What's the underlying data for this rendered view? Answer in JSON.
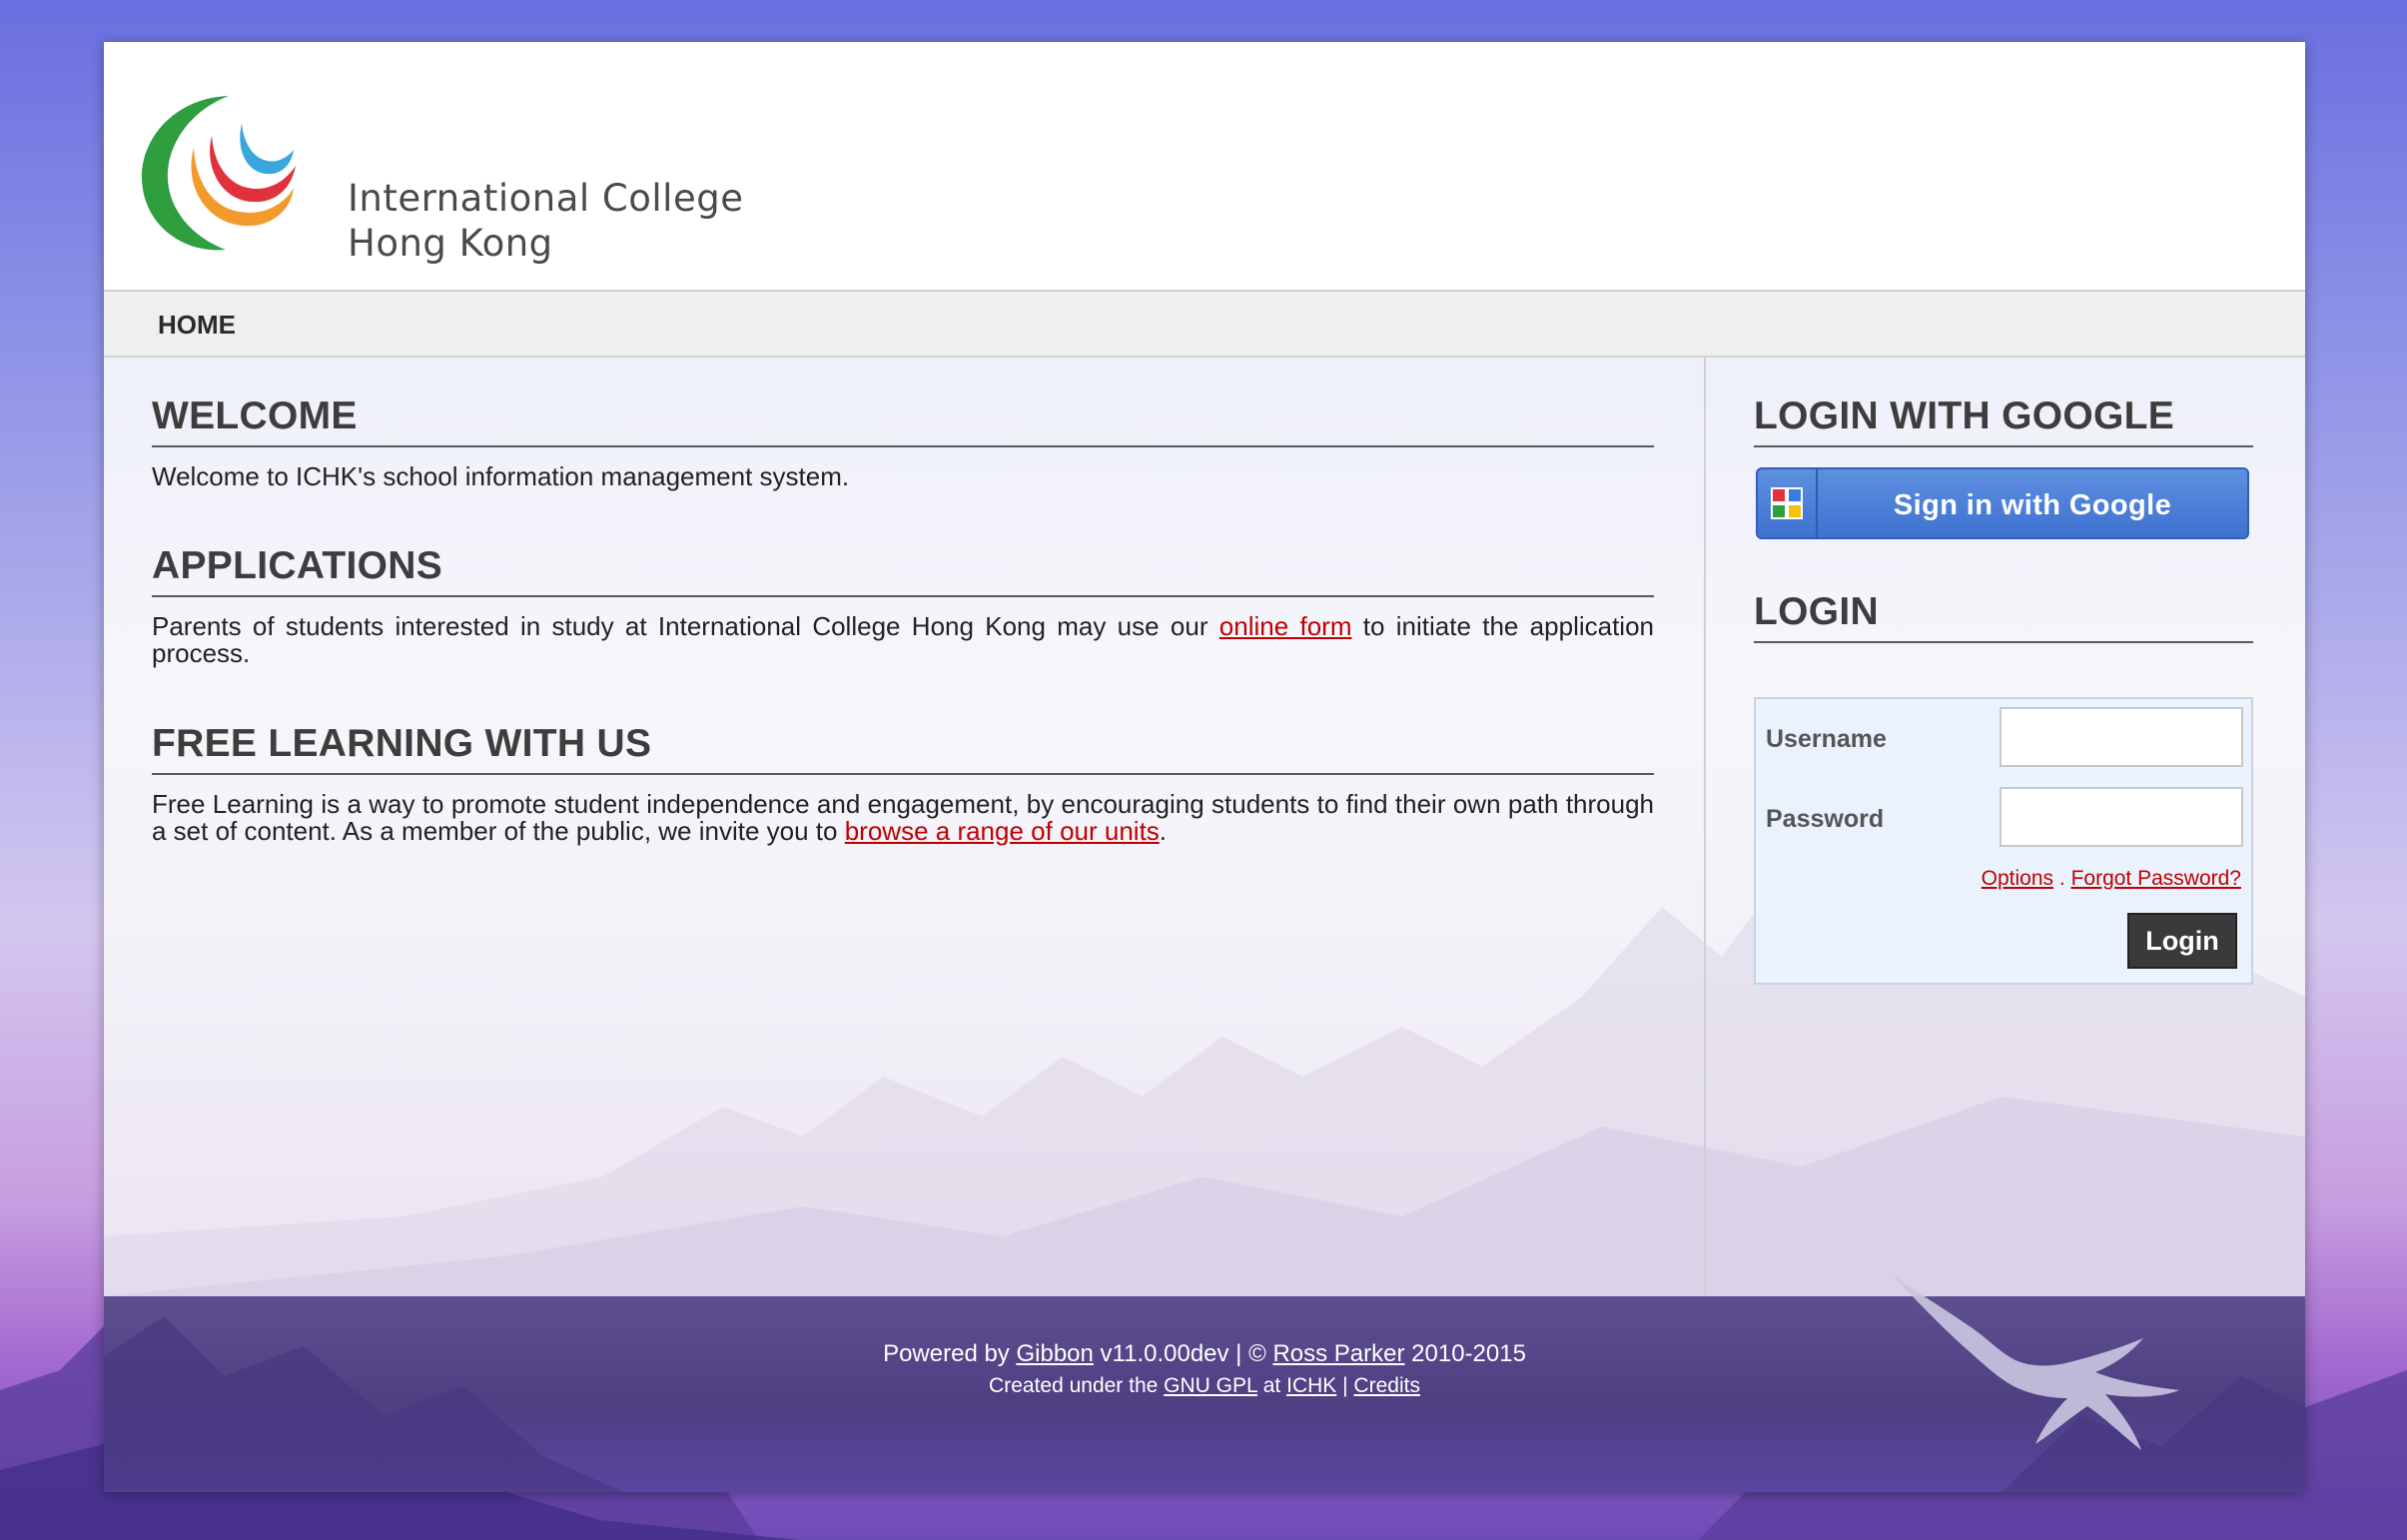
{
  "logo": {
    "line1": "International College",
    "line2": "Hong Kong"
  },
  "nav": {
    "home": "HOME"
  },
  "main": {
    "welcome": {
      "heading": "WELCOME",
      "text": "Welcome to ICHK's school information management system."
    },
    "applications": {
      "heading": "APPLICATIONS",
      "text_before": "Parents of students interested in study at International College Hong Kong may use our ",
      "link": "online form",
      "text_after": " to initiate the application process."
    },
    "free_learning": {
      "heading": "FREE LEARNING WITH US",
      "text_before": "Free Learning is a way to promote student independence and engagement, by encouraging students to find their own path through a set of content. As a member of the public, we invite you to ",
      "link": "browse a range of our units",
      "text_after": "."
    }
  },
  "sidebar": {
    "google": {
      "heading": "LOGIN WITH GOOGLE",
      "button": "Sign in with Google"
    },
    "login": {
      "heading": "LOGIN",
      "username_label": "Username",
      "password_label": "Password",
      "username_value": "",
      "password_value": "",
      "options_link": "Options",
      "separator": ".",
      "forgot_link": "Forgot Password?",
      "login_button": "Login"
    }
  },
  "footer": {
    "powered_by": "Powered by ",
    "gibbon": "Gibbon",
    "version": " v11.0.00dev | © ",
    "author": "Ross Parker",
    "years": " 2010-2015",
    "created_under": "Created under the ",
    "license": "GNU GPL",
    "at": " at ",
    "ichk": "ICHK",
    "pipe": " | ",
    "credits": "Credits"
  },
  "colors": {
    "link_red": "#c00000",
    "google_blue": "#3e72d0",
    "login_box_bg": "#eaf3fd",
    "heading": "#3d3d3d",
    "footer_bg": "#4d3f82"
  },
  "icons": {
    "logo": "ichk-swirl-logo-icon",
    "google": "google-plus-icon",
    "flyer": "flying-figure-icon"
  }
}
